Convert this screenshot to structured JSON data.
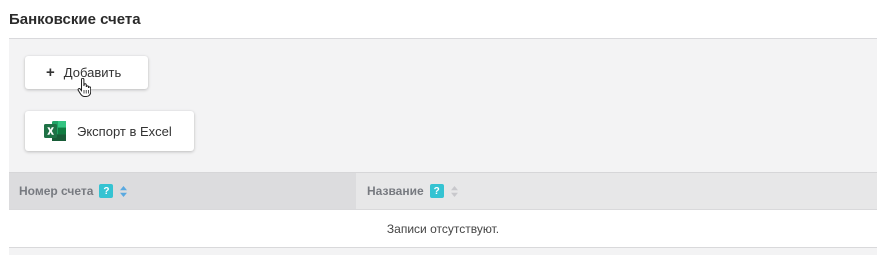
{
  "section": {
    "title": "Банковские счета"
  },
  "toolbar": {
    "add_label": "Добавить",
    "export_label": "Экспорт в Excel",
    "add_icon": "plus-icon",
    "export_icon": "excel-icon"
  },
  "table": {
    "columns": [
      {
        "label": "Номер счета",
        "help": "?",
        "sort_state": "active"
      },
      {
        "label": "Название",
        "help": "?",
        "sort_state": "inactive"
      }
    ],
    "empty_message": "Записи отсутствуют."
  },
  "colors": {
    "help_badge": "#35c3d2",
    "sort_active": "#5aa9e0",
    "sort_inactive": "#c8c8cc",
    "excel_green": "#1e7145"
  }
}
